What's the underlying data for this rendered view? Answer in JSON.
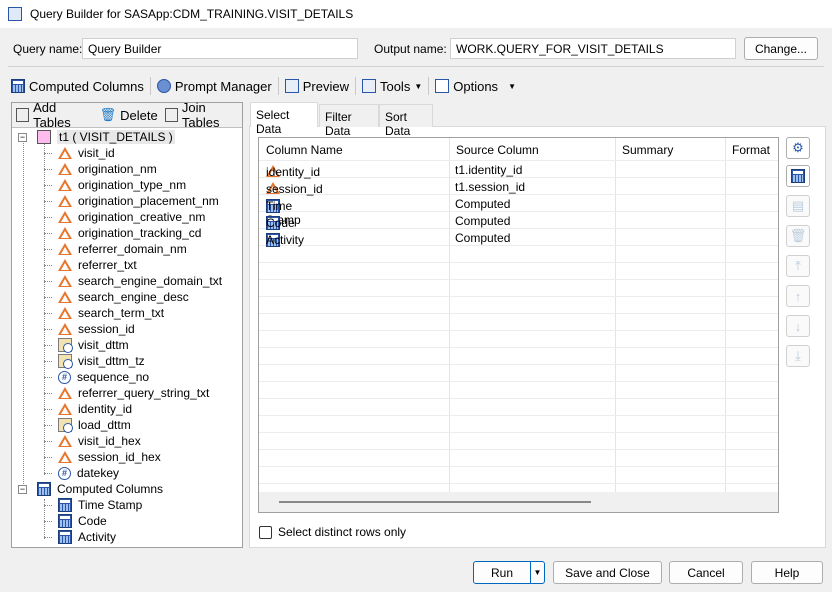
{
  "window": {
    "title": "Query Builder for SASApp:CDM_TRAINING.VISIT_DETAILS"
  },
  "header": {
    "query_name_label": "Query name:",
    "query_name": "Query Builder",
    "output_name_label": "Output name:",
    "output_name": "WORK.QUERY_FOR_VISIT_DETAILS",
    "change_label": "Change..."
  },
  "toolbar": {
    "computed_columns": "Computed Columns",
    "prompt_manager": "Prompt Manager",
    "preview": "Preview",
    "tools": "Tools",
    "options": "Options"
  },
  "left": {
    "add_tables": "Add Tables",
    "delete": "Delete",
    "join_tables": "Join Tables",
    "table_label": "t1 ( VISIT_DETAILS )",
    "columns": [
      {
        "name": "visit_id",
        "type": "char"
      },
      {
        "name": "origination_nm",
        "type": "char"
      },
      {
        "name": "origination_type_nm",
        "type": "char"
      },
      {
        "name": "origination_placement_nm",
        "type": "char"
      },
      {
        "name": "origination_creative_nm",
        "type": "char"
      },
      {
        "name": "origination_tracking_cd",
        "type": "char"
      },
      {
        "name": "referrer_domain_nm",
        "type": "char"
      },
      {
        "name": "referrer_txt",
        "type": "char"
      },
      {
        "name": "search_engine_domain_txt",
        "type": "char"
      },
      {
        "name": "search_engine_desc",
        "type": "char"
      },
      {
        "name": "search_term_txt",
        "type": "char"
      },
      {
        "name": "session_id",
        "type": "char"
      },
      {
        "name": "visit_dttm",
        "type": "datetime"
      },
      {
        "name": "visit_dttm_tz",
        "type": "datetime"
      },
      {
        "name": "sequence_no",
        "type": "numeric"
      },
      {
        "name": "referrer_query_string_txt",
        "type": "char"
      },
      {
        "name": "identity_id",
        "type": "char"
      },
      {
        "name": "load_dttm",
        "type": "datetime"
      },
      {
        "name": "visit_id_hex",
        "type": "char"
      },
      {
        "name": "session_id_hex",
        "type": "char"
      },
      {
        "name": "datekey",
        "type": "numeric"
      }
    ],
    "computed_label": "Computed Columns",
    "computed": [
      "Time Stamp",
      "Code",
      "Activity"
    ]
  },
  "tabs": [
    "Select Data",
    "Filter Data",
    "Sort Data"
  ],
  "grid": {
    "headers": [
      "Column Name",
      "Source Column",
      "Summary",
      "Format"
    ],
    "rows": [
      {
        "name": "identity_id",
        "source": "t1.identity_id",
        "type": "char"
      },
      {
        "name": "session_id",
        "source": "t1.session_id",
        "type": "char"
      },
      {
        "name": "Time Stamp",
        "source": "Computed",
        "type": "computed"
      },
      {
        "name": "Code",
        "source": "Computed",
        "type": "computed"
      },
      {
        "name": "Activity",
        "source": "Computed",
        "type": "computed"
      }
    ]
  },
  "distinct_label": "Select distinct rows only",
  "footer": {
    "run": "Run",
    "save_close": "Save and Close",
    "cancel": "Cancel",
    "help": "Help"
  }
}
